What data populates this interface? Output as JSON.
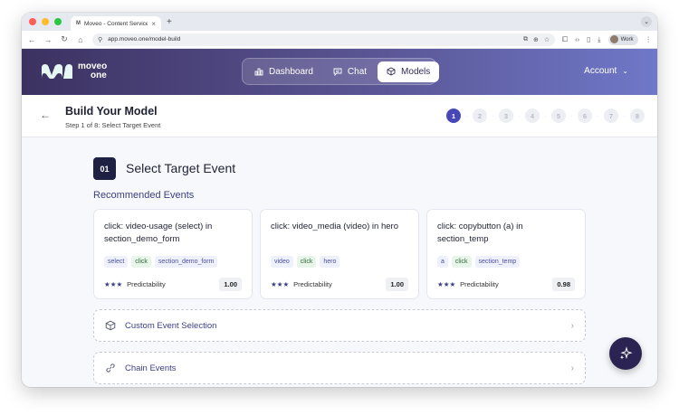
{
  "browser": {
    "tab_title": "Moveo - Content Service",
    "tab_favicon": "M",
    "url": "app.moveo.one/model-build",
    "profile_label": "Work",
    "traffic_colors": [
      "#ff5f57",
      "#febc2e",
      "#28c840"
    ]
  },
  "header": {
    "logo_top": "moveo",
    "logo_bottom": "one",
    "nav": [
      {
        "label": "Dashboard",
        "icon": "bar-chart-icon"
      },
      {
        "label": "Chat",
        "icon": "chat-icon"
      },
      {
        "label": "Models",
        "icon": "cube-icon",
        "active": true
      }
    ],
    "account_label": "Account"
  },
  "step": {
    "title": "Build Your Model",
    "subtitle": "Step 1 of 8: Select Target Event",
    "steps": [
      "1",
      "2",
      "3",
      "4",
      "5",
      "6",
      "7",
      "8"
    ],
    "current": 1
  },
  "section": {
    "number": "01",
    "title": "Select Target Event",
    "recommended_title": "Recommended Events"
  },
  "cards": [
    {
      "title": "click: video-usage (select) in section_demo_form",
      "tags": [
        {
          "text": "select",
          "kind": "blue"
        },
        {
          "text": "click",
          "kind": "green"
        },
        {
          "text": "section_demo_form",
          "kind": "blue"
        }
      ],
      "predictability_label": "Predictability",
      "stars": "★★★",
      "score": "1.00"
    },
    {
      "title": "click: video_media (video) in hero",
      "tags": [
        {
          "text": "video",
          "kind": "blue"
        },
        {
          "text": "click",
          "kind": "green"
        },
        {
          "text": "hero",
          "kind": "blue"
        }
      ],
      "predictability_label": "Predictability",
      "stars": "★★★",
      "score": "1.00"
    },
    {
      "title": "click: copybutton (a) in section_temp",
      "tags": [
        {
          "text": "a",
          "kind": "blue"
        },
        {
          "text": "click",
          "kind": "green"
        },
        {
          "text": "section_temp",
          "kind": "blue"
        }
      ],
      "predictability_label": "Predictability",
      "stars": "★★★",
      "score": "0.98"
    }
  ],
  "options": [
    {
      "label": "Custom Event Selection",
      "icon": "cube-outline-icon"
    },
    {
      "label": "Chain Events",
      "icon": "link-icon"
    }
  ],
  "colors": {
    "accent": "#4747b8",
    "header_start": "#3c3261",
    "header_end": "#6f78c8",
    "fab": "#2b2453"
  }
}
